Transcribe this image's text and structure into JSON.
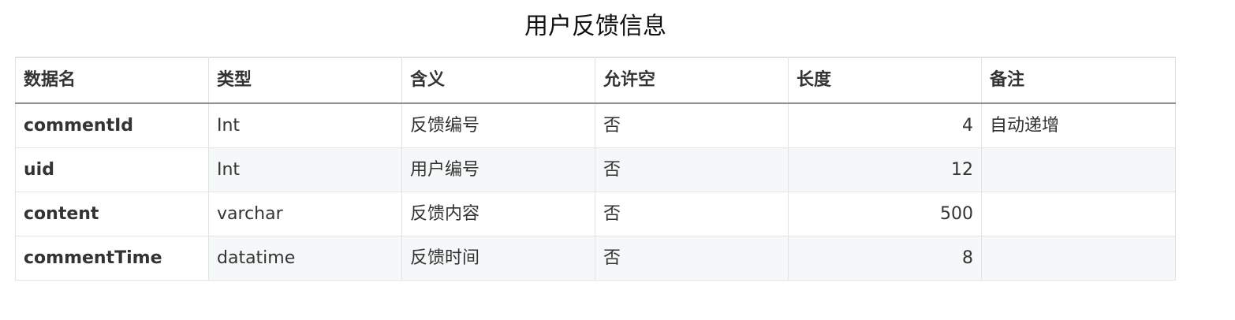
{
  "title": "用户反馈信息",
  "table": {
    "headers": [
      "数据名",
      "类型",
      "含义",
      "允许空",
      "长度",
      "备注"
    ],
    "rows": [
      {
        "name": "commentId",
        "type": "Int",
        "meaning": "反馈编号",
        "nullable": "否",
        "length": "4",
        "note": "自动递增"
      },
      {
        "name": "uid",
        "type": "Int",
        "meaning": "用户编号",
        "nullable": "否",
        "length": "12",
        "note": ""
      },
      {
        "name": "content",
        "type": "varchar",
        "meaning": "反馈内容",
        "nullable": "否",
        "length": "500",
        "note": ""
      },
      {
        "name": "commentTime",
        "type": "datatime",
        "meaning": "反馈时间",
        "nullable": "否",
        "length": "8",
        "note": ""
      }
    ]
  }
}
